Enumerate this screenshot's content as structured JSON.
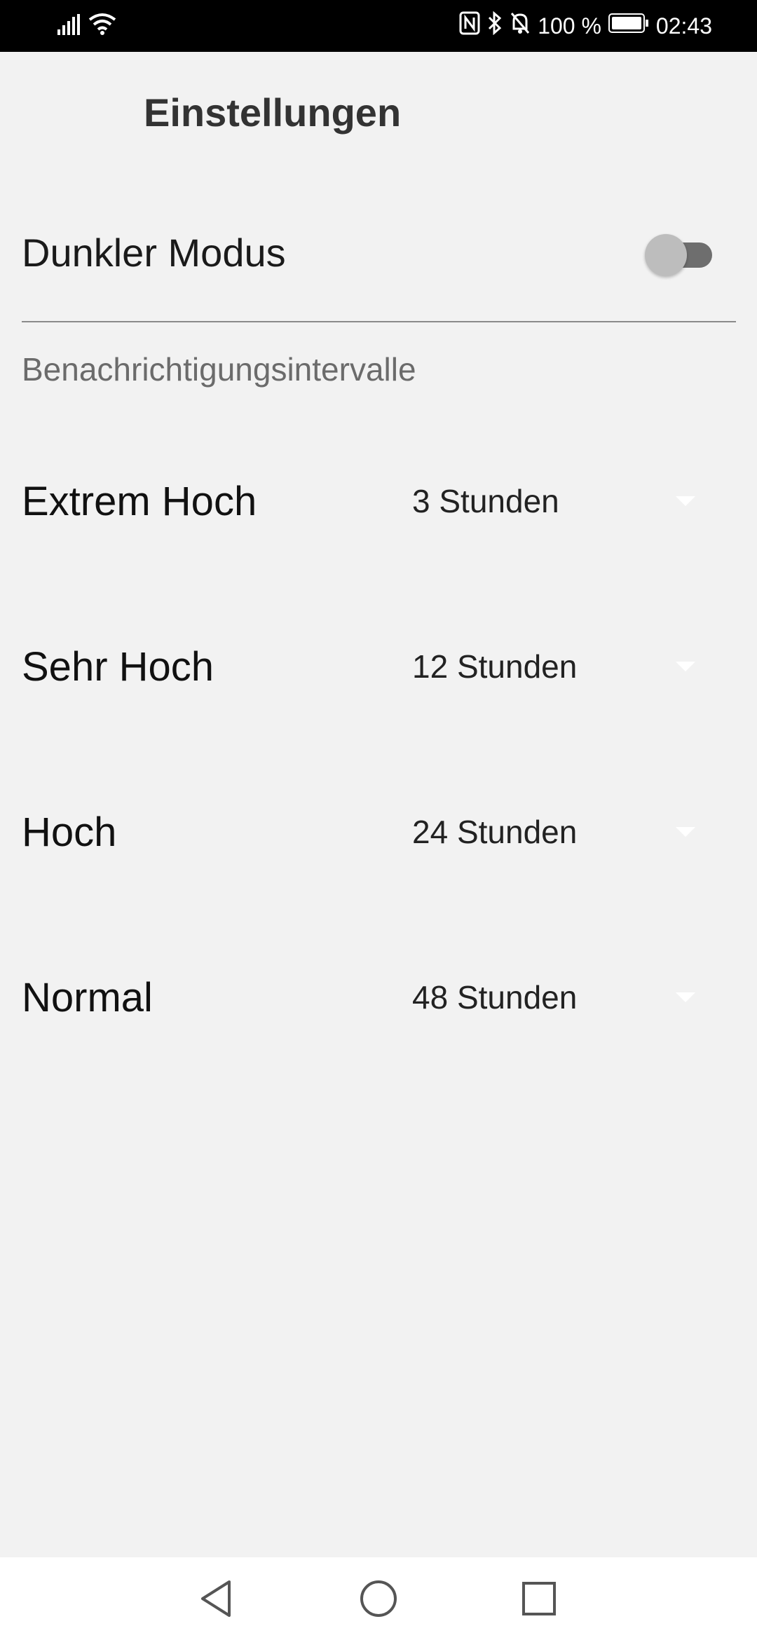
{
  "status_bar": {
    "battery_percent": "100 %",
    "time": "02:43",
    "icons": [
      "signal-icon",
      "wifi-icon",
      "nfc-icon",
      "bluetooth-icon",
      "bell-off-icon",
      "battery-icon"
    ]
  },
  "app_bar": {
    "title": "Einstellungen"
  },
  "dark_mode": {
    "label": "Dunkler Modus",
    "enabled": false
  },
  "notifications": {
    "section_title": "Benachrichtigungsintervalle",
    "items": [
      {
        "label": "Extrem Hoch",
        "value": "3 Stunden"
      },
      {
        "label": "Sehr Hoch",
        "value": "12 Stunden"
      },
      {
        "label": "Hoch",
        "value": "24 Stunden"
      },
      {
        "label": "Normal",
        "value": "48 Stunden"
      }
    ]
  },
  "nav_bar": {
    "buttons": [
      "back-icon",
      "home-icon",
      "recents-icon"
    ]
  },
  "colors": {
    "background": "#f2f2f2",
    "status_bar": "#000000",
    "switch_track": "#6e6e6e",
    "switch_thumb": "#bdbdbd"
  }
}
